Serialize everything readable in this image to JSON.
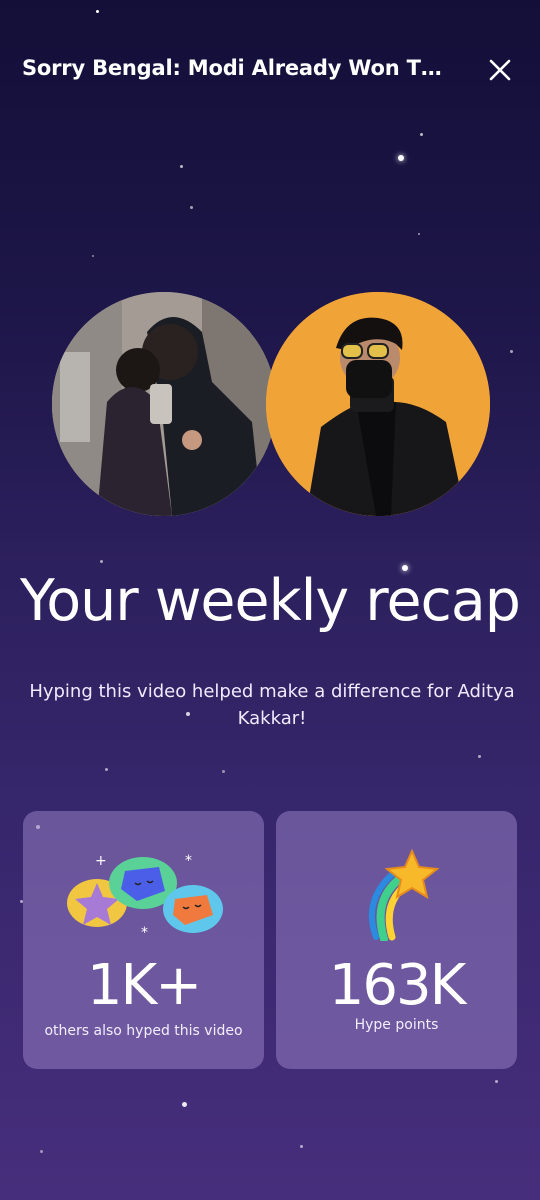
{
  "header": {
    "title": "Sorry Bengal: Modi Already Won The..."
  },
  "avatars": [
    {
      "name": "video-thumbnail-avatar"
    },
    {
      "name": "creator-avatar-aditya-kakkar"
    }
  ],
  "recap": {
    "heading": "Your weekly recap",
    "subtitle": "Hyping this video helped make a difference for Aditya Kakkar!"
  },
  "stats": [
    {
      "value": "1K+",
      "label": "others also hyped this video",
      "icon": "friends-faces-icon"
    },
    {
      "value": "163K",
      "label": "Hype points",
      "icon": "shooting-star-icon"
    }
  ],
  "colors": {
    "accent_star": "#f7b82a",
    "card_bg": "#8b74b6"
  }
}
